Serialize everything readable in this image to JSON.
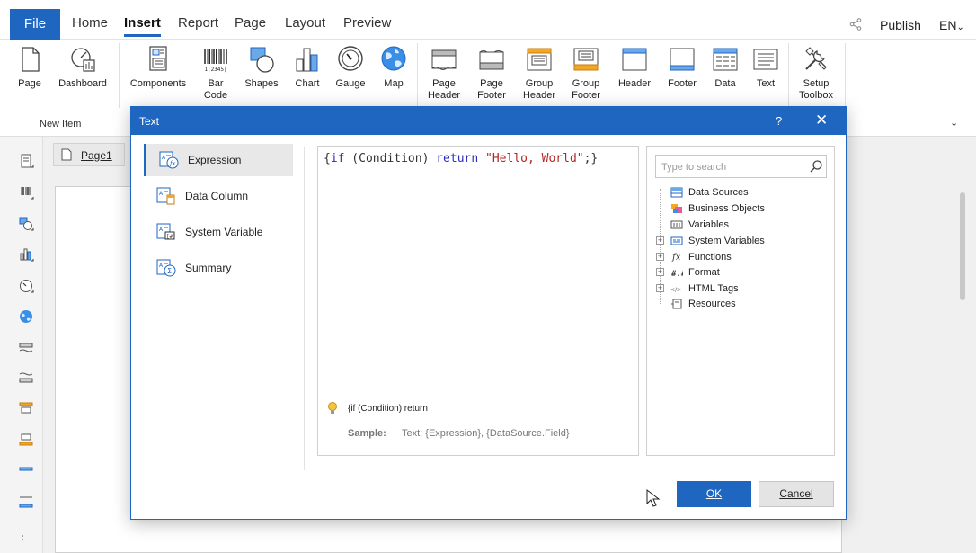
{
  "menu": {
    "file": "File",
    "tabs": [
      "Home",
      "Insert",
      "Report",
      "Page",
      "Layout",
      "Preview"
    ],
    "active_tab": "Insert",
    "publish": "Publish",
    "language": "EN"
  },
  "ribbon": {
    "group_label": "New Item",
    "page": "Page",
    "dashboard": "Dashboard",
    "components": "Components",
    "barcode_1": "Bar",
    "barcode_2": "Code",
    "barcode_digits": "1|2345|",
    "shapes": "Shapes",
    "chart": "Chart",
    "gauge": "Gauge",
    "map": "Map",
    "page_header_1": "Page",
    "page_header_2": "Header",
    "page_footer_1": "Page",
    "page_footer_2": "Footer",
    "group_header_1": "Group",
    "group_header_2": "Header",
    "group_footer_1": "Group",
    "group_footer_2": "Footer",
    "header": "Header",
    "footer": "Footer",
    "data": "Data",
    "text": "Text",
    "setup_toolbox_1": "Setup",
    "setup_toolbox_2": "Toolbox",
    "accent_color": "#1f66c1",
    "band_color": "#f5a623"
  },
  "design": {
    "page_tab": "Page1"
  },
  "dialog": {
    "title": "Text",
    "help": "?",
    "close": "✕",
    "sidebar": [
      {
        "label": "Expression",
        "selected": true
      },
      {
        "label": "Data Column",
        "selected": false
      },
      {
        "label": "System Variable",
        "selected": false
      },
      {
        "label": "Summary",
        "selected": false
      }
    ],
    "code": {
      "open": "{",
      "kw_if": "if",
      "cond": " (Condition) ",
      "kw_return": "return",
      "sp": " ",
      "str": "\"Hello, World\"",
      "close": ";}"
    },
    "hint": "{if (Condition) return",
    "sample_label": "Sample:",
    "sample_value": "Text: {Expression},   {DataSource.Field}",
    "search_placeholder": "Type to search",
    "tree": [
      {
        "label": "Data Sources",
        "expandable": false
      },
      {
        "label": "Business Objects",
        "expandable": false
      },
      {
        "label": "Variables",
        "expandable": false
      },
      {
        "label": "System Variables",
        "expandable": true
      },
      {
        "label": "Functions",
        "expandable": true
      },
      {
        "label": "Format",
        "expandable": true
      },
      {
        "label": "HTML Tags",
        "expandable": true
      },
      {
        "label": "Resources",
        "expandable": false
      }
    ],
    "ok": "OK",
    "cancel": "Cancel"
  }
}
